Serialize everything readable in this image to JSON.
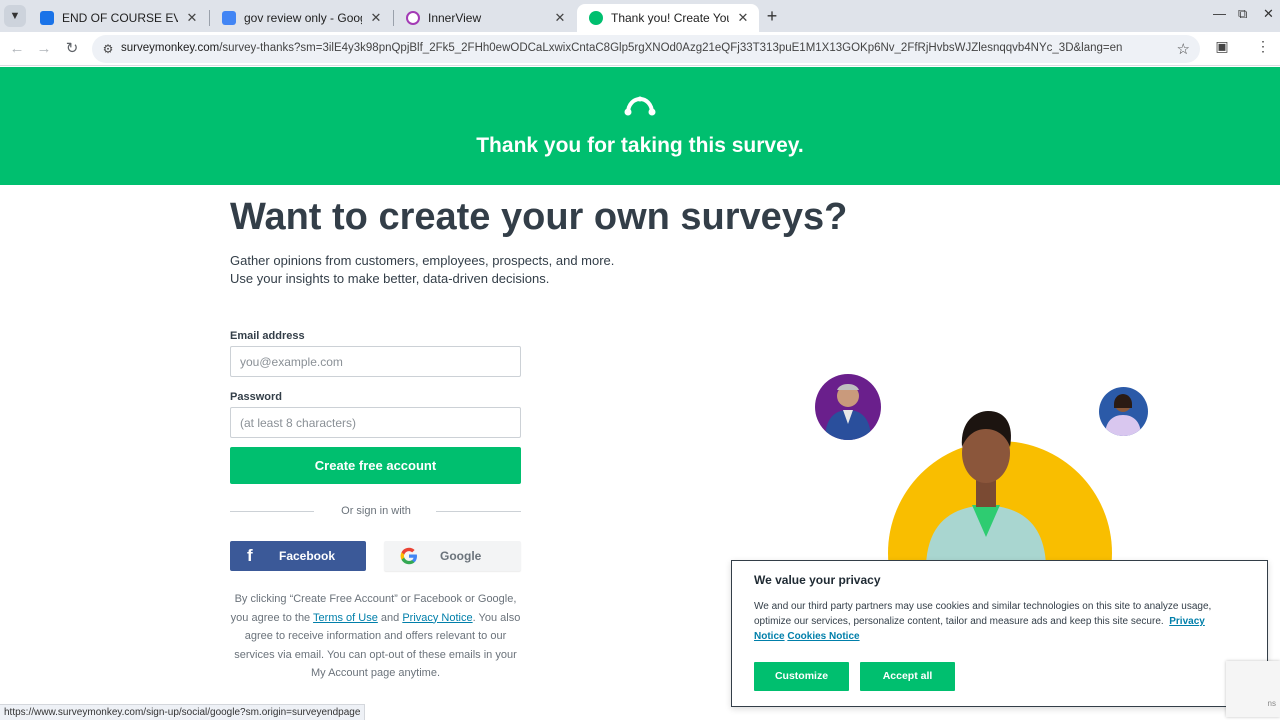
{
  "browser": {
    "tabs": [
      {
        "title": "END OF COURSE EVAL",
        "favicon_color": "#1a73e8",
        "active": false
      },
      {
        "title": "gov review only - Google Docs",
        "favicon_color": "#4285f4",
        "active": false
      },
      {
        "title": "InnerView",
        "favicon_color": "#a33bb5",
        "active": false
      },
      {
        "title": "Thank you! Create Your Own Or",
        "favicon_color": "#00bf6f",
        "active": true
      }
    ],
    "url_host": "surveymonkey.com",
    "url_path": "/survey-thanks?sm=3ilE4y3k98pnQpjBlf_2Fk5_2FHh0ewODCaLxwixCntaC8Glp5rgXNOd0Azg21eQFj33T313puE1M1X13GOKp6Nv_2FfRjHvbsWJZlesnqqvb4NYc_3D&lang=en"
  },
  "hero": {
    "title": "Thank you for taking this survey."
  },
  "signup": {
    "headline": "Want to create your own surveys?",
    "subtitle_line1": "Gather opinions from customers, employees, prospects, and more.",
    "subtitle_line2": "Use your insights to make better, data-driven decisions.",
    "email_label": "Email address",
    "email_placeholder": "you@example.com",
    "email_value": "",
    "password_label": "Password",
    "password_placeholder": "(at least 8 characters)",
    "password_value": "",
    "create_button": "Create free account",
    "or_sign_in": "Or sign in with",
    "facebook_button": "Facebook",
    "google_button": "Google",
    "legal_1": "By clicking “Create Free Account” or Facebook or Google, you agree to the ",
    "terms_link": "Terms of Use",
    "legal_and": " and ",
    "privacy_link": "Privacy Notice",
    "legal_2": ". You also agree to receive information and offers relevant to our services via email. You can opt-out of these emails in your My Account page anytime."
  },
  "cookie_banner": {
    "title": "We value your privacy",
    "text": "We and our third party partners may use cookies and similar technologies on this site to analyze usage, optimize our services, personalize content, tailor and measure ads and keep this site secure.",
    "privacy_link": "Privacy Notice",
    "cookies_link": "Cookies Notice",
    "customize_button": "Customize",
    "accept_button": "Accept all"
  },
  "status_bar": {
    "url": "https://www.surveymonkey.com/sign-up/social/google?sm.origin=surveyendpage"
  },
  "recaptcha": {
    "text": "ns"
  },
  "colors": {
    "brand_green": "#00bf6f",
    "facebook_blue": "#3b5998",
    "illustration_yellow": "#f9be00",
    "link_blue": "#007faa"
  },
  "icons": {
    "tab_menu": "chevron-down-icon",
    "back": "arrow-left-icon",
    "forward": "arrow-right-icon",
    "reload": "reload-icon",
    "site_info": "tune-icon",
    "bookmark": "star-icon",
    "extensions": "puzzle-icon",
    "menu": "kebab-menu-icon"
  }
}
